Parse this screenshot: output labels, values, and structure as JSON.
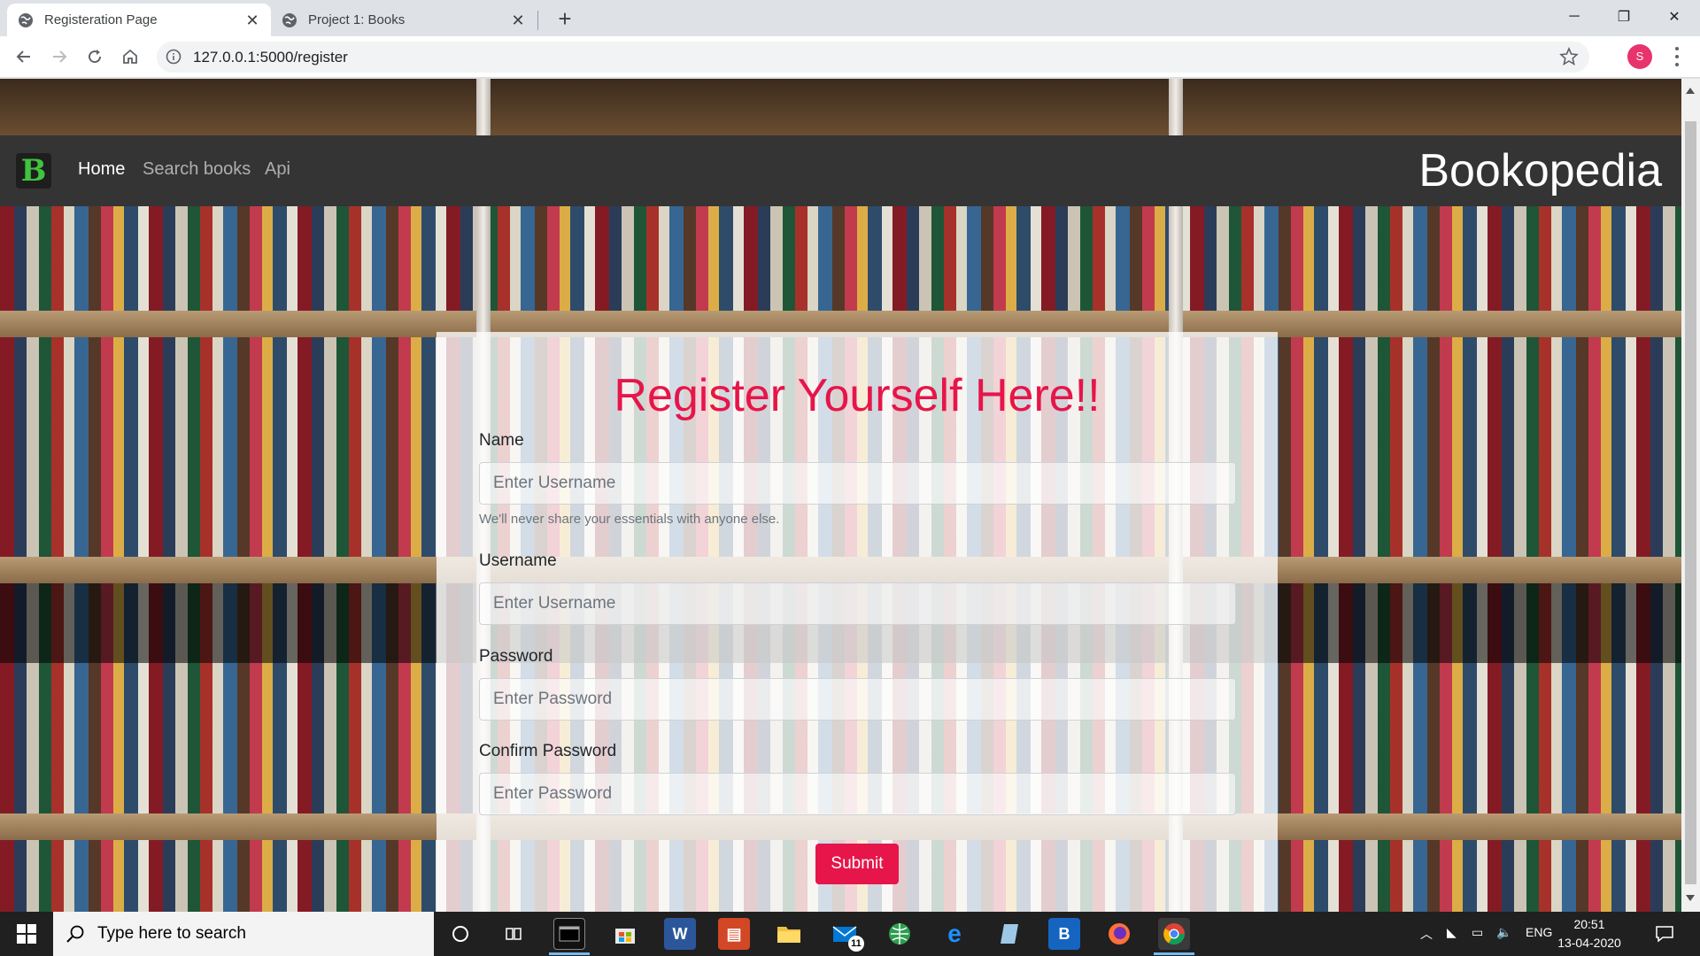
{
  "browser": {
    "tabs": [
      {
        "title": "Registeration Page",
        "active": true
      },
      {
        "title": "Project 1: Books",
        "active": false
      }
    ],
    "url": "127.0.0.1:5000/register",
    "profile_initial": "S"
  },
  "site": {
    "logo_letter": "B",
    "nav": [
      {
        "label": "Home",
        "active": true
      },
      {
        "label": "Search books",
        "active": false
      },
      {
        "label": "Api",
        "active": false
      }
    ],
    "brand": "Bookopedia"
  },
  "form": {
    "title": "Register Yourself Here!!",
    "name_label": "Name",
    "name_placeholder": "Enter Username",
    "help_text": "We'll never share your essentials with anyone else.",
    "username_label": "Username",
    "username_placeholder": "Enter Username",
    "password_label": "Password",
    "password_placeholder": "Enter Password",
    "confirm_label": "Confirm Password",
    "confirm_placeholder": "Enter Password",
    "submit_label": "Submit"
  },
  "taskbar": {
    "search_placeholder": "Type here to search",
    "mail_badge": "11",
    "language": "ENG",
    "time": "20:51",
    "date": "13-04-2020"
  },
  "colors": {
    "accent": "#e6154a",
    "navbar": "#343434",
    "logo_green": "#3ec43e"
  }
}
